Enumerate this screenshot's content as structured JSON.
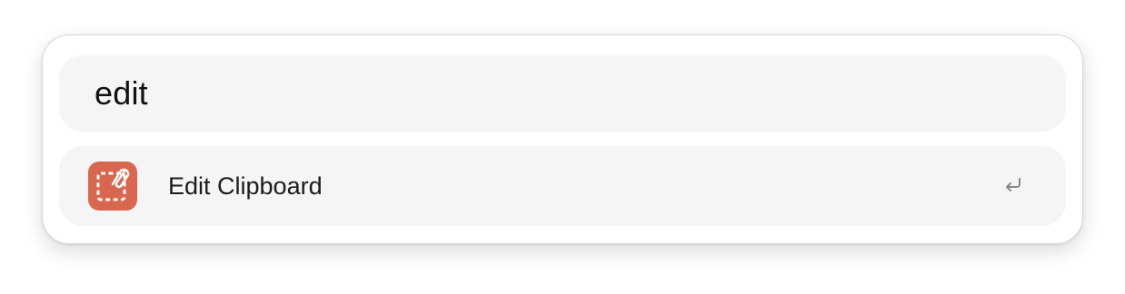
{
  "search": {
    "query": "edit"
  },
  "results": [
    {
      "label": "Edit Clipboard",
      "icon": "clipboard-edit-icon",
      "icon_color": "#d9674f",
      "action_icon": "return-key-icon"
    }
  ]
}
